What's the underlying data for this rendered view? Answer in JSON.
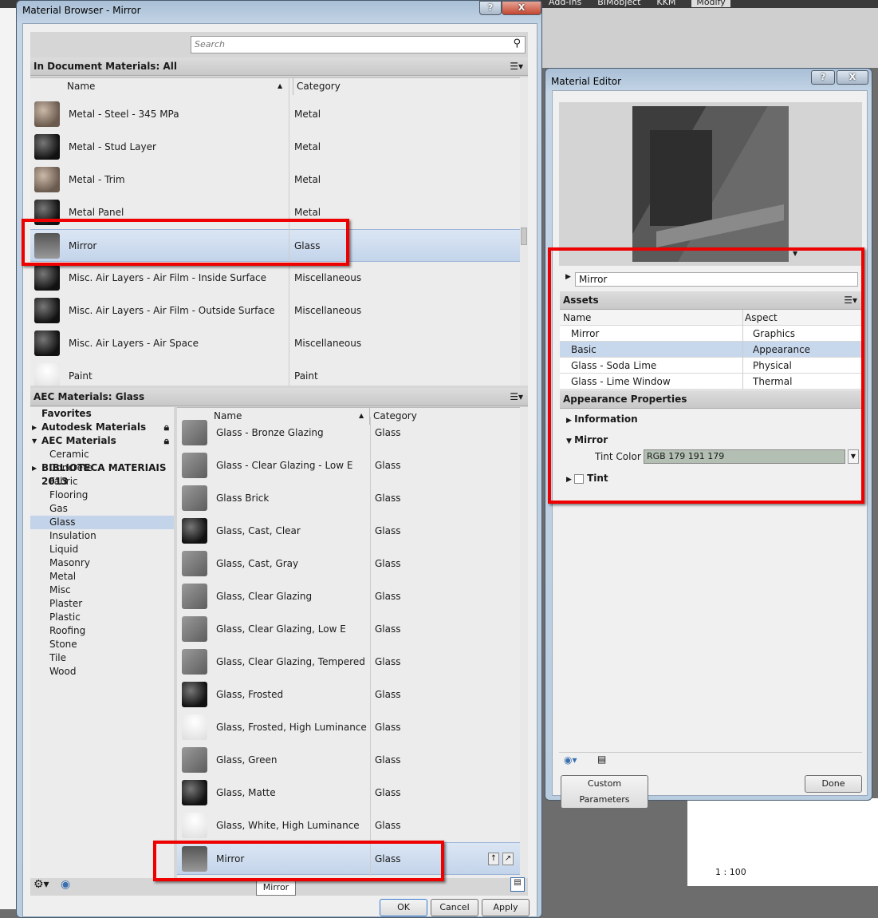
{
  "background": {
    "ribbon_tabs": [
      "Add-Ins",
      "BIMobject",
      "KKM",
      "Modify"
    ],
    "scale": "1 : 100"
  },
  "browser": {
    "title": "Material Browser - Mirror",
    "search_placeholder": "Search",
    "doc_header": "In Document Materials: All",
    "col_name": "Name",
    "col_category": "Category",
    "doc_rows": [
      {
        "name": "Metal - Steel - 345 MPa",
        "category": "Metal",
        "thumb": "sphere"
      },
      {
        "name": "Metal - Stud Layer",
        "category": "Metal",
        "thumb": "dark"
      },
      {
        "name": "Metal - Trim",
        "category": "Metal",
        "thumb": "sphere"
      },
      {
        "name": "Metal Panel",
        "category": "Metal",
        "thumb": "dark"
      },
      {
        "name": "Mirror",
        "category": "Glass",
        "thumb": "mirror"
      },
      {
        "name": "Misc. Air Layers - Air Film - Inside Surface",
        "category": "Miscellaneous",
        "thumb": "dark"
      },
      {
        "name": "Misc. Air Layers - Air Film - Outside Surface",
        "category": "Miscellaneous",
        "thumb": "dark"
      },
      {
        "name": "Misc. Air Layers - Air Space",
        "category": "Miscellaneous",
        "thumb": "dark"
      },
      {
        "name": "Paint",
        "category": "Paint",
        "thumb": "white"
      }
    ],
    "lib_header": "AEC Materials: Glass",
    "tree": {
      "favorites": "Favorites",
      "autodesk": "Autodesk Materials",
      "aec": "AEC Materials",
      "children": [
        "Ceramic",
        "Concrete",
        "Fabric",
        "Flooring",
        "Gas",
        "Glass",
        "Insulation",
        "Liquid",
        "Masonry",
        "Metal",
        "Misc",
        "Plaster",
        "Plastic",
        "Roofing",
        "Stone",
        "Tile",
        "Wood"
      ],
      "biblioteca": "BIBLIOTECA MATERIAIS 2013"
    },
    "lib_rows": [
      {
        "name": "Glass - Bronze Glazing",
        "category": "Glass",
        "thumb": "glass"
      },
      {
        "name": "Glass - Clear Glazing - Low E",
        "category": "Glass",
        "thumb": "glass"
      },
      {
        "name": "Glass Brick",
        "category": "Glass",
        "thumb": "glass"
      },
      {
        "name": "Glass, Cast, Clear",
        "category": "Glass",
        "thumb": "dark"
      },
      {
        "name": "Glass, Cast, Gray",
        "category": "Glass",
        "thumb": "glass"
      },
      {
        "name": "Glass, Clear Glazing",
        "category": "Glass",
        "thumb": "glass"
      },
      {
        "name": "Glass, Clear Glazing, Low E",
        "category": "Glass",
        "thumb": "glass"
      },
      {
        "name": "Glass, Clear Glazing, Tempered",
        "category": "Glass",
        "thumb": "glass"
      },
      {
        "name": "Glass, Frosted",
        "category": "Glass",
        "thumb": "dark"
      },
      {
        "name": "Glass, Frosted, High Luminance",
        "category": "Glass",
        "thumb": "white"
      },
      {
        "name": "Glass, Green",
        "category": "Glass",
        "thumb": "glass"
      },
      {
        "name": "Glass, Matte",
        "category": "Glass",
        "thumb": "dark"
      },
      {
        "name": "Glass, White, High Luminance",
        "category": "Glass",
        "thumb": "white"
      },
      {
        "name": "Mirror",
        "category": "Glass",
        "thumb": "mirror"
      }
    ],
    "tooltip": "Mirror",
    "ok": "OK",
    "cancel": "Cancel",
    "apply": "Apply"
  },
  "editor": {
    "title": "Material Editor",
    "material_name": "Mirror",
    "assets_header": "Assets",
    "col_name": "Name",
    "col_aspect": "Aspect",
    "assets": [
      {
        "name": "Mirror",
        "aspect": "Graphics"
      },
      {
        "name": "Basic",
        "aspect": "Appearance"
      },
      {
        "name": "Glass - Soda Lime",
        "aspect": "Physical"
      },
      {
        "name": "Glass - Lime Window",
        "aspect": "Thermal"
      }
    ],
    "appearance_header": "Appearance Properties",
    "information": "Information",
    "mirror_section": "Mirror",
    "tint_color_label": "Tint Color",
    "tint_color_value": "RGB 179 191 179",
    "tint_section": "Tint",
    "custom_parameters": "Custom Parameters",
    "done": "Done"
  },
  "colors": {
    "highlight": "#e00000",
    "selection": "#c3d4ea",
    "tint": "#b3bfb3"
  }
}
